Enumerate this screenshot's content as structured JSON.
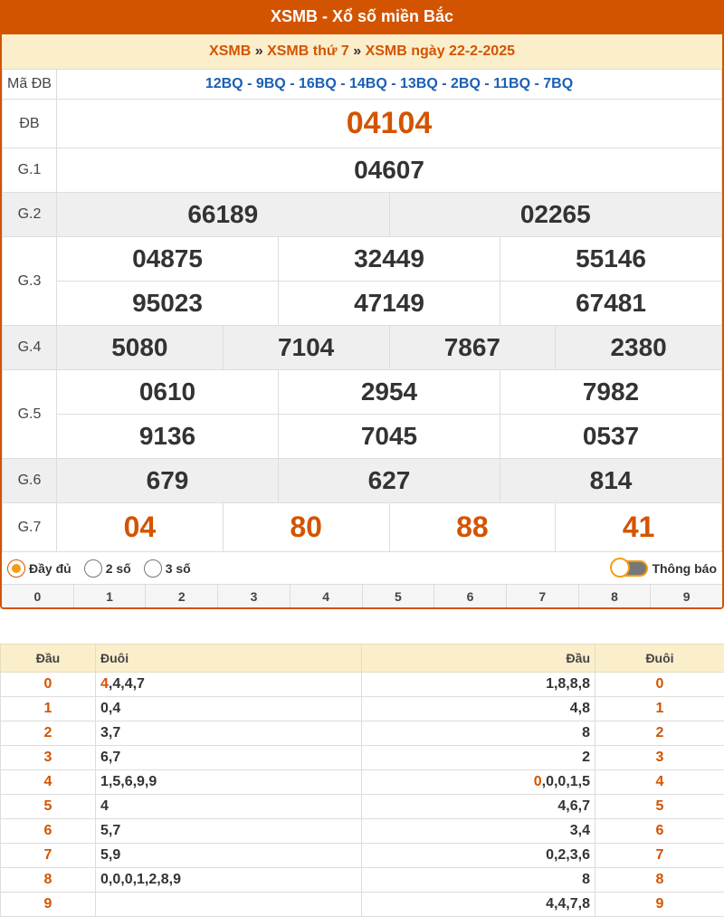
{
  "header": {
    "title": "XSMB - Xổ số miền Bắc"
  },
  "breadcrumb": {
    "item1": "XSMB",
    "sep": "»",
    "item2": "XSMB thứ 7",
    "item3": "XSMB ngày 22-2-2025"
  },
  "ma_db": {
    "label": "Mã ĐB",
    "value": "12BQ - 9BQ - 16BQ - 14BQ - 13BQ - 2BQ - 11BQ - 7BQ"
  },
  "prizes": {
    "db": {
      "label": "ĐB",
      "values": [
        "04104"
      ]
    },
    "g1": {
      "label": "G.1",
      "values": [
        "04607"
      ]
    },
    "g2": {
      "label": "G.2",
      "values": [
        "66189",
        "02265"
      ]
    },
    "g3": {
      "label": "G.3",
      "values": [
        "04875",
        "32449",
        "55146",
        "95023",
        "47149",
        "67481"
      ]
    },
    "g4": {
      "label": "G.4",
      "values": [
        "5080",
        "7104",
        "7867",
        "2380"
      ]
    },
    "g5": {
      "label": "G.5",
      "values": [
        "0610",
        "2954",
        "7982",
        "9136",
        "7045",
        "0537"
      ]
    },
    "g6": {
      "label": "G.6",
      "values": [
        "679",
        "627",
        "814"
      ]
    },
    "g7": {
      "label": "G.7",
      "values": [
        "04",
        "80",
        "88",
        "41"
      ]
    }
  },
  "options": {
    "full": "Đầy đủ",
    "two": "2 số",
    "three": "3 số",
    "notify": "Thông báo",
    "selected": "Đầy đủ"
  },
  "digit_filter": [
    "0",
    "1",
    "2",
    "3",
    "4",
    "5",
    "6",
    "7",
    "8",
    "9"
  ],
  "loto": {
    "headers": {
      "dau": "Đầu",
      "duoi": "Đuôi",
      "dau2": "Đầu",
      "duoi2": "Đuôi"
    },
    "rows": [
      {
        "dau": "0",
        "duoi_hl": "4",
        "duoi_rest": ",4,4,7",
        "dau2_hl": "",
        "dau2_rest": "1,8,8,8",
        "duoi2": "0"
      },
      {
        "dau": "1",
        "duoi_hl": "",
        "duoi_rest": "0,4",
        "dau2_hl": "",
        "dau2_rest": "4,8",
        "duoi2": "1"
      },
      {
        "dau": "2",
        "duoi_hl": "",
        "duoi_rest": "3,7",
        "dau2_hl": "",
        "dau2_rest": "8",
        "duoi2": "2"
      },
      {
        "dau": "3",
        "duoi_hl": "",
        "duoi_rest": "6,7",
        "dau2_hl": "",
        "dau2_rest": "2",
        "duoi2": "3"
      },
      {
        "dau": "4",
        "duoi_hl": "",
        "duoi_rest": "1,5,6,9,9",
        "dau2_hl": "0",
        "dau2_rest": ",0,0,1,5",
        "duoi2": "4"
      },
      {
        "dau": "5",
        "duoi_hl": "",
        "duoi_rest": "4",
        "dau2_hl": "",
        "dau2_rest": "4,6,7",
        "duoi2": "5"
      },
      {
        "dau": "6",
        "duoi_hl": "",
        "duoi_rest": "5,7",
        "dau2_hl": "",
        "dau2_rest": "3,4",
        "duoi2": "6"
      },
      {
        "dau": "7",
        "duoi_hl": "",
        "duoi_rest": "5,9",
        "dau2_hl": "",
        "dau2_rest": "0,2,3,6",
        "duoi2": "7"
      },
      {
        "dau": "8",
        "duoi_hl": "",
        "duoi_rest": "0,0,0,1,2,8,9",
        "dau2_hl": "",
        "dau2_rest": "8",
        "duoi2": "8"
      },
      {
        "dau": "9",
        "duoi_hl": "",
        "duoi_rest": "",
        "dau2_hl": "",
        "dau2_rest": "4,4,7,8",
        "duoi2": "9"
      }
    ]
  },
  "colors": {
    "brand": "#d35400",
    "accent": "#f39c12",
    "breadcrumb_bg": "#fbeecb",
    "ma_db": "#1a5fb4"
  }
}
